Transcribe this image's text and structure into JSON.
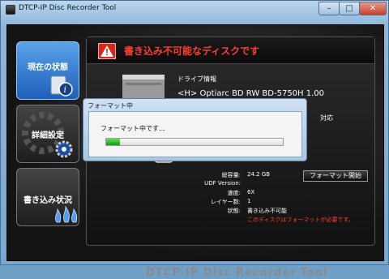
{
  "window": {
    "title": "DTCP-IP Disc Recorder Tool"
  },
  "nav": [
    {
      "label": "現在の状態"
    },
    {
      "label": "詳細設定"
    },
    {
      "label": "書き込み状況"
    }
  ],
  "status": {
    "warning": "書き込み不可能なディスクです",
    "drive_section": "ドライブ情報",
    "drive_name": "<H> Optiarc BD RW BD-5750H 1.00",
    "support_label_visible": "S:",
    "support_value": "対応"
  },
  "disc_info": {
    "rows": [
      {
        "key": "総容量:",
        "value": "24.2 GB"
      },
      {
        "key": "UDF Version:",
        "value": ""
      },
      {
        "key": "速度:",
        "value": "6X"
      },
      {
        "key": "レイヤー数:",
        "value": "1"
      },
      {
        "key": "状態:",
        "value": "書き込み不可能"
      }
    ],
    "note": "このディスクはフォーマットが必要です。"
  },
  "format_button": "フォーマット開始",
  "brand": "DTCP-IP Disc Recorder Tool",
  "dialog": {
    "title": "フォーマット中",
    "message": "フォーマット中です…",
    "progress": 0.04
  },
  "colors": {
    "active_nav": "#2f78d0",
    "warning": "#ff3d2e",
    "progress": "#1fb31f"
  }
}
